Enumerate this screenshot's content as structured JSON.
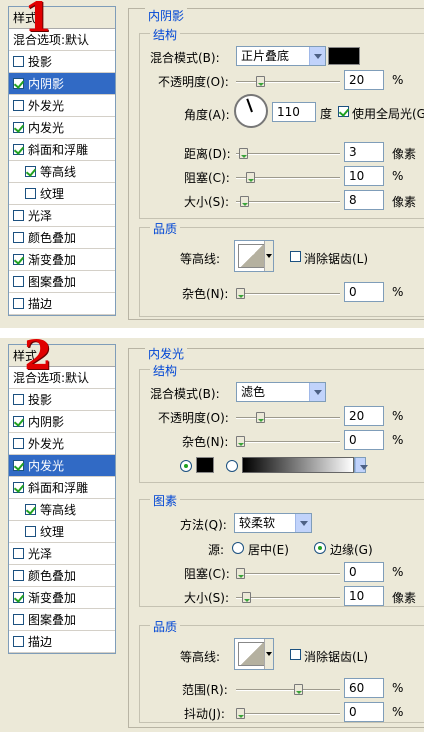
{
  "panel1": {
    "number": "1",
    "list_header": "样式",
    "blend_options": "混合选项:默认",
    "items": [
      {
        "label": "投影",
        "checked": false,
        "selected": false,
        "indent": false
      },
      {
        "label": "内阴影",
        "checked": true,
        "selected": true,
        "indent": false
      },
      {
        "label": "外发光",
        "checked": false,
        "selected": false,
        "indent": false
      },
      {
        "label": "内发光",
        "checked": true,
        "selected": false,
        "indent": false
      },
      {
        "label": "斜面和浮雕",
        "checked": true,
        "selected": false,
        "indent": false
      },
      {
        "label": "等高线",
        "checked": true,
        "selected": false,
        "indent": true
      },
      {
        "label": "纹理",
        "checked": false,
        "selected": false,
        "indent": true
      },
      {
        "label": "光泽",
        "checked": false,
        "selected": false,
        "indent": false
      },
      {
        "label": "颜色叠加",
        "checked": false,
        "selected": false,
        "indent": false
      },
      {
        "label": "渐变叠加",
        "checked": true,
        "selected": false,
        "indent": false
      },
      {
        "label": "图案叠加",
        "checked": false,
        "selected": false,
        "indent": false
      },
      {
        "label": "描边",
        "checked": false,
        "selected": false,
        "indent": false
      }
    ],
    "section_title": "内阴影",
    "structure_title": "结构",
    "blend_mode_label": "混合模式(B):",
    "blend_mode_value": "正片叠底",
    "opacity_label": "不透明度(O):",
    "opacity_value": "20",
    "opacity_unit": "%",
    "angle_label": "角度(A):",
    "angle_value": "110",
    "angle_unit": "度",
    "global_light_label": "使用全局光(G)",
    "distance_label": "距离(D):",
    "distance_value": "3",
    "distance_unit": "像素",
    "choke_label": "阻塞(C):",
    "choke_value": "10",
    "choke_unit": "%",
    "size_label": "大小(S):",
    "size_value": "8",
    "size_unit": "像素",
    "quality_title": "品质",
    "contour_label": "等高线:",
    "antialias_label": "消除锯齿(L)",
    "noise_label": "杂色(N):",
    "noise_value": "0",
    "noise_unit": "%"
  },
  "panel2": {
    "number": "2",
    "list_header": "样式",
    "blend_options": "混合选项:默认",
    "items": [
      {
        "label": "投影",
        "checked": false,
        "selected": false,
        "indent": false
      },
      {
        "label": "内阴影",
        "checked": true,
        "selected": false,
        "indent": false
      },
      {
        "label": "外发光",
        "checked": false,
        "selected": false,
        "indent": false
      },
      {
        "label": "内发光",
        "checked": true,
        "selected": true,
        "indent": false
      },
      {
        "label": "斜面和浮雕",
        "checked": true,
        "selected": false,
        "indent": false
      },
      {
        "label": "等高线",
        "checked": true,
        "selected": false,
        "indent": true
      },
      {
        "label": "纹理",
        "checked": false,
        "selected": false,
        "indent": true
      },
      {
        "label": "光泽",
        "checked": false,
        "selected": false,
        "indent": false
      },
      {
        "label": "颜色叠加",
        "checked": false,
        "selected": false,
        "indent": false
      },
      {
        "label": "渐变叠加",
        "checked": true,
        "selected": false,
        "indent": false
      },
      {
        "label": "图案叠加",
        "checked": false,
        "selected": false,
        "indent": false
      },
      {
        "label": "描边",
        "checked": false,
        "selected": false,
        "indent": false
      }
    ],
    "section_title": "内发光",
    "structure_title": "结构",
    "blend_mode_label": "混合模式(B):",
    "blend_mode_value": "滤色",
    "opacity_label": "不透明度(O):",
    "opacity_value": "20",
    "opacity_unit": "%",
    "noise_label": "杂色(N):",
    "noise_value": "0",
    "noise_unit": "%",
    "elements_title": "图素",
    "method_label": "方法(Q):",
    "method_value": "较柔软",
    "source_label": "源:",
    "center_label": "居中(E)",
    "edge_label": "边缘(G)",
    "choke_label": "阻塞(C):",
    "choke_value": "0",
    "choke_unit": "%",
    "size_label": "大小(S):",
    "size_value": "10",
    "size_unit": "像素",
    "quality_title": "品质",
    "contour_label": "等高线:",
    "antialias_label": "消除锯齿(L)",
    "range_label": "范围(R):",
    "range_value": "60",
    "range_unit": "%",
    "jitter_label": "抖动(J):",
    "jitter_value": "0",
    "jitter_unit": "%"
  },
  "colors": {
    "accent": "#0046d5",
    "selection": "#316ac5",
    "number": "#e00000"
  }
}
